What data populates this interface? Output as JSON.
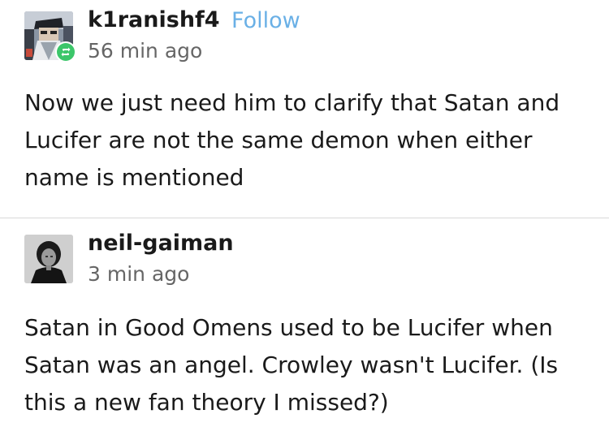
{
  "posts": [
    {
      "username": "k1ranishf4",
      "follow_label": "Follow",
      "timestamp": "56 min ago",
      "body": "Now we just need him to clarify that Satan and Lucifer are not the same demon when either name is mentioned",
      "avatar_icon": "user-avatar",
      "badge_icon": "reblog-icon",
      "badge_color": "#3cc66a"
    },
    {
      "username": "neil-gaiman",
      "timestamp": "3 min ago",
      "body": "Satan in Good Omens used to be Lucifer when Satan was an angel. Crowley wasn't Lucifer. (Is this a new fan theory I missed?)",
      "avatar_icon": "user-avatar"
    }
  ],
  "colors": {
    "follow_link": "#6ab0e6",
    "timestamp": "#666666",
    "divider": "#d9d9d9"
  }
}
